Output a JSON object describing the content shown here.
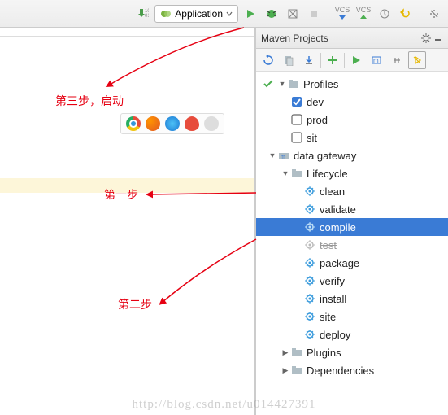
{
  "toolbar": {
    "down_binary_icon": "⬇",
    "run_config_label": "Application",
    "vcs_label": "VCS"
  },
  "annotations": {
    "step3": "第三步，启动",
    "step1": "第一步",
    "step2": "第二步"
  },
  "panel": {
    "title": "Maven Projects"
  },
  "tree": {
    "profiles": {
      "label": "Profiles",
      "dev": "dev",
      "prod": "prod",
      "sit": "sit"
    },
    "project": {
      "label": "data gateway"
    },
    "lifecycle": {
      "label": "Lifecycle",
      "clean": "clean",
      "validate": "validate",
      "compile": "compile",
      "test": "test",
      "package": "package",
      "verify": "verify",
      "install": "install",
      "site": "site",
      "deploy": "deploy"
    },
    "plugins": "Plugins",
    "dependencies": "Dependencies"
  },
  "watermark": "http://blog.csdn.net/u014427391"
}
